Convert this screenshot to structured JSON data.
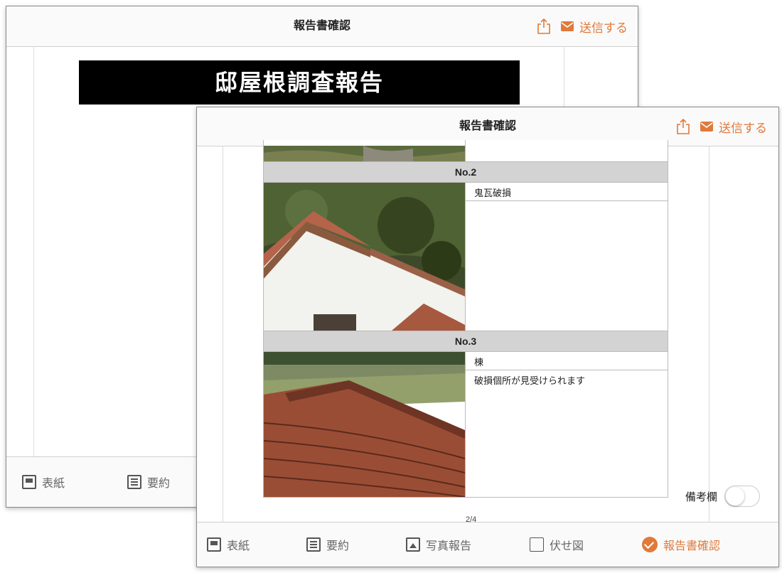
{
  "navbar": {
    "title": "報告書確認",
    "send_label": "送信する"
  },
  "back_screen": {
    "cover_title": "邸屋根調査報告",
    "tabs": [
      {
        "label": "表紙",
        "icon": "cover-icon"
      },
      {
        "label": "要約",
        "icon": "list-icon"
      }
    ]
  },
  "front_screen": {
    "rows": [
      {
        "no": "No.2",
        "title": "鬼瓦破損",
        "comment": ""
      },
      {
        "no": "No.3",
        "title": "棟",
        "comment": "破損個所が見受けられます"
      }
    ],
    "remarks_label": "備考欄",
    "remarks_on": false,
    "page_indicator": "2/4",
    "tabs": [
      {
        "label": "表紙",
        "icon": "cover-icon"
      },
      {
        "label": "要約",
        "icon": "list-icon"
      },
      {
        "label": "写真報告",
        "icon": "photo-icon"
      },
      {
        "label": "伏せ図",
        "icon": "plan-icon"
      },
      {
        "label": "報告書確認",
        "icon": "check-icon"
      }
    ]
  },
  "colors": {
    "accent": "#e07a3a",
    "header_gray": "#d3d3d3"
  }
}
